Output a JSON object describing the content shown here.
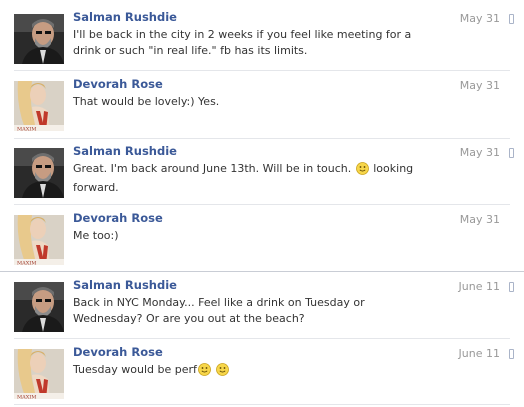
{
  "thread": {
    "messages": [
      {
        "sender": "Salman Rushdie",
        "avatar": "avatar-salman",
        "text": "I'll be back in the city in 2 weeks if you feel like meeting for a drink or such \"in real life.\" fb has its limits.",
        "date": "May 31",
        "mobile_icon": true
      },
      {
        "sender": "Devorah Rose",
        "avatar": "avatar-devorah",
        "text": "That would be lovely:) Yes.",
        "date": "May 31",
        "mobile_icon": false
      },
      {
        "sender": "Salman Rushdie",
        "avatar": "avatar-salman",
        "text_before": "Great. I'm back around June 13th. Will be in touch.",
        "text_after": "looking forward.",
        "date": "May 31",
        "mobile_icon": true
      },
      {
        "sender": "Devorah Rose",
        "avatar": "avatar-devorah",
        "text": "Me too:)",
        "date": "May 31",
        "mobile_icon": false
      },
      {
        "sender": "Salman Rushdie",
        "avatar": "avatar-salman",
        "text": "Back in NYC Monday... Feel like a drink on Tuesday or Wednesday? Or are you out at the beach?",
        "date": "June 11",
        "mobile_icon": true
      },
      {
        "sender": "Devorah Rose",
        "avatar": "avatar-devorah",
        "text_before": "Tuesday would be perf",
        "date": "June 11",
        "mobile_icon": true
      }
    ]
  },
  "icons": {
    "smiley": "smiley-icon",
    "mobile": "mobile-phone-icon"
  },
  "colors": {
    "sender_link": "#3b5998",
    "date": "#999999",
    "body_text": "#333333",
    "divider": "#e4e6ea"
  }
}
